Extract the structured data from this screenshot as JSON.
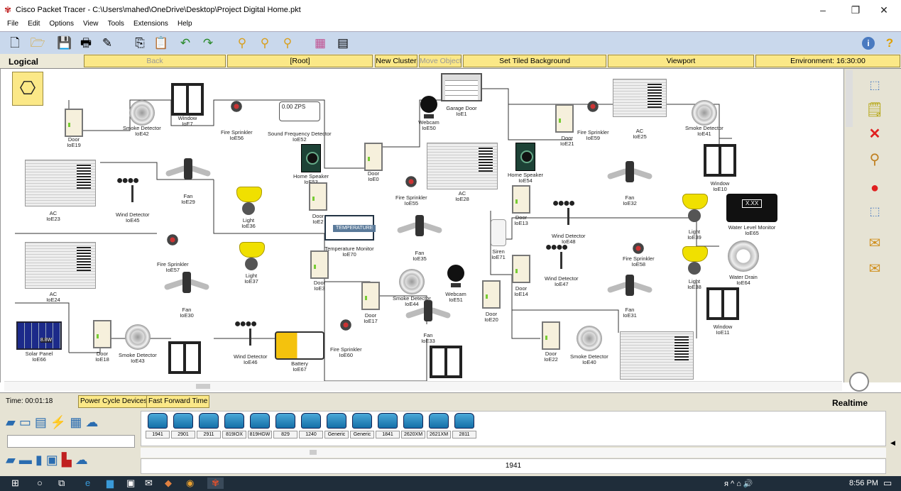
{
  "window": {
    "title": "Cisco Packet Tracer - C:\\Users\\mahed\\OneDrive\\Desktop\\Project Digital Home.pkt",
    "minimize": "–",
    "maximize": "❐",
    "close": "✕"
  },
  "menu": [
    "File",
    "Edit",
    "Options",
    "View",
    "Tools",
    "Extensions",
    "Help"
  ],
  "toolbar": {
    "icons": [
      "new-file-icon",
      "open-folder-icon",
      "save-icon",
      "print-icon",
      "activity-wizard-icon",
      "copy-icon",
      "paste-icon",
      "undo-icon",
      "redo-icon",
      "zoom-in-icon",
      "zoom-reset-icon",
      "zoom-out-icon",
      "palette-icon",
      "custom-device-icon"
    ],
    "info": "i",
    "help": "?"
  },
  "logical_bar": {
    "mode": "Logical",
    "back": "Back",
    "root": "[Root]",
    "new_cluster": "New Cluster",
    "move_object": "Move Object",
    "tiled_bg": "Set Tiled Background",
    "viewport": "Viewport",
    "environment": "Environment: 16:30:00"
  },
  "devices": [
    {
      "label": "Door\nIoE19",
      "type": "door"
    },
    {
      "label": "Smoke Detector\nIoE42",
      "type": "smoke"
    },
    {
      "label": "Window\nIoE7",
      "type": "window"
    },
    {
      "label": "Fire Sprinkler\nIoE56",
      "type": "sprinkler"
    },
    {
      "label": "Sound Frequency Detector\nIoE52",
      "type": "sfd",
      "display": "0.00 ZPS"
    },
    {
      "label": "Webcam\nIoE50",
      "type": "cam"
    },
    {
      "label": "Garage Door\nIoE1",
      "type": "garage"
    },
    {
      "label": "Door\nIoE21",
      "type": "door"
    },
    {
      "label": "Fire Sprinkler\nIoE59",
      "type": "sprinkler"
    },
    {
      "label": "AC\nIoE25",
      "type": "ac"
    },
    {
      "label": "Smoke Detector\nIoE41",
      "type": "smoke"
    },
    {
      "label": "AC\nIoE23",
      "type": "ac"
    },
    {
      "label": "Wind Detector\nIoE45",
      "type": "wind"
    },
    {
      "label": "Fan\nIoE29",
      "type": "fan"
    },
    {
      "label": "Light\nIoE36",
      "type": "light"
    },
    {
      "label": "Home Speaker\nIoE53",
      "type": "speaker"
    },
    {
      "label": "Door\nIoE0",
      "type": "door"
    },
    {
      "label": "AC\nIoE28",
      "type": "ac"
    },
    {
      "label": "Home Speaker\nIoE54",
      "type": "speaker"
    },
    {
      "label": "Fan\nIoE32",
      "type": "fan"
    },
    {
      "label": "Window\nIoE10",
      "type": "window"
    },
    {
      "label": "Door\nIoE2",
      "type": "door"
    },
    {
      "label": "Fire Sprinkler\nIoE55",
      "type": "sprinkler"
    },
    {
      "label": "Door\nIoE13",
      "type": "door"
    },
    {
      "label": "Wind Detector\nIoE48",
      "type": "wind"
    },
    {
      "label": "Light\nIoE39",
      "type": "light"
    },
    {
      "label": "Water Level Monitor\nIoE65",
      "type": "level",
      "display": "X.XX"
    },
    {
      "label": "AC\nIoE24",
      "type": "ac"
    },
    {
      "label": "Fire Sprinkler\nIoE57",
      "type": "sprinkler"
    },
    {
      "label": "Light\nIoE37",
      "type": "light"
    },
    {
      "label": "Temperature Monitor\nIoE70",
      "type": "temp",
      "display": "TEMPERATURE"
    },
    {
      "label": "Fan\nIoE35",
      "type": "fan"
    },
    {
      "label": "Siren\nIoE71",
      "type": "siren"
    },
    {
      "label": "Wind Detector\nIoE47",
      "type": "wind"
    },
    {
      "label": "Fire Sprinkler\nIoE58",
      "type": "sprinkler"
    },
    {
      "label": "Light\nIoE38",
      "type": "light"
    },
    {
      "label": "Water Drain\nIoE64",
      "type": "drain"
    },
    {
      "label": "Fan\nIoE30",
      "type": "fan"
    },
    {
      "label": "Door\nIoE3",
      "type": "door"
    },
    {
      "label": "Smoke Detector\nIoE44",
      "type": "smoke"
    },
    {
      "label": "Webcam\nIoE51",
      "type": "cam"
    },
    {
      "label": "Door\nIoE14",
      "type": "door"
    },
    {
      "label": "Fan\nIoE31",
      "type": "fan"
    },
    {
      "label": "Door\nIoE17",
      "type": "door"
    },
    {
      "label": "Door\nIoE20",
      "type": "door"
    },
    {
      "label": "Window\nIoE11",
      "type": "window"
    },
    {
      "label": "Solar Panel\nIoE66",
      "type": "solar",
      "display": "8.8W"
    },
    {
      "label": "Door\nIoE18",
      "type": "door"
    },
    {
      "label": "Smoke Detector\nIoE43",
      "type": "smoke"
    },
    {
      "label": "Wind Detector\nIoE46",
      "type": "wind"
    },
    {
      "label": "Battery\nIoE67",
      "type": "battery"
    },
    {
      "label": "Fire Sprinkler\nIoE60",
      "type": "sprinkler"
    },
    {
      "label": "Fan\nIoE33",
      "type": "fan"
    },
    {
      "label": "Door\nIoE22",
      "type": "door"
    },
    {
      "label": "Smoke Detector\nIoE40",
      "type": "smoke"
    },
    {
      "label": "",
      "type": "window"
    },
    {
      "label": "",
      "type": "window"
    },
    {
      "label": "",
      "type": "ac"
    }
  ],
  "right_panel": [
    "select-icon",
    "inspect-note-icon",
    "delete-icon",
    "zoom-icon",
    "draw-shape-icon",
    "resize-icon",
    "pdu-simple-icon",
    "pdu-complex-icon"
  ],
  "status": {
    "time": "Time: 00:01:18",
    "power_cycle": "Power Cycle Devices",
    "fast_forward": "Fast Forward Time",
    "mode": "Realtime"
  },
  "device_models": [
    "1941",
    "2901",
    "2911",
    "819IOX",
    "819HGW",
    "829",
    "1240",
    "Generic",
    "Generic",
    "1841",
    "2620XM",
    "2621XM",
    "2811"
  ],
  "selected_model": "1941",
  "taskbar": {
    "clock": "8:56 PM",
    "tray": "ᴙ ^ ⌂ 🔊"
  }
}
